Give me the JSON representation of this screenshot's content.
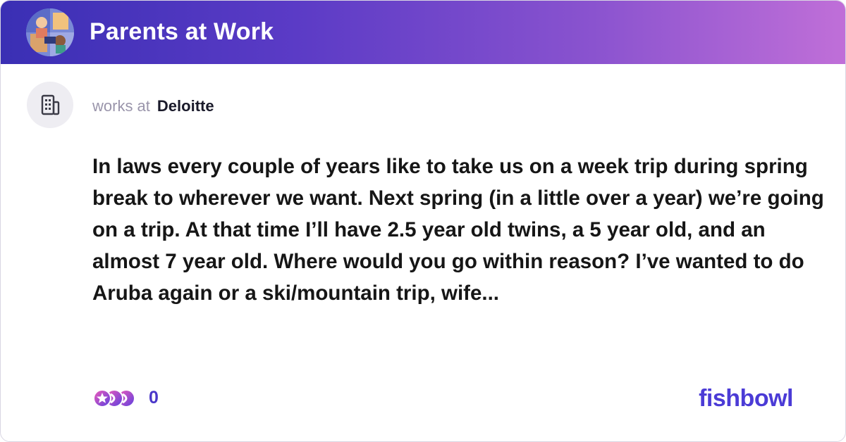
{
  "header": {
    "group_name": "Parents at Work"
  },
  "author": {
    "works_at_label": "works at",
    "company": "Deloitte"
  },
  "post": {
    "text": "In laws every couple of years like to take us on a week trip during spring break to wherever we want. Next spring (in a little over a year) we’re going on a trip. At that time I’ll have 2.5 year old twins, a 5 year old, and an almost 7 year old. Where would you go within reason? I’ve wanted to do Aruba again or a ski/mountain trip, wife..."
  },
  "footer": {
    "reaction_count": "0",
    "brand": "fishbowl"
  },
  "colors": {
    "header_gradient_start": "#3a2fb4",
    "header_gradient_end": "#c06fd8",
    "accent": "#4b3bd6"
  }
}
